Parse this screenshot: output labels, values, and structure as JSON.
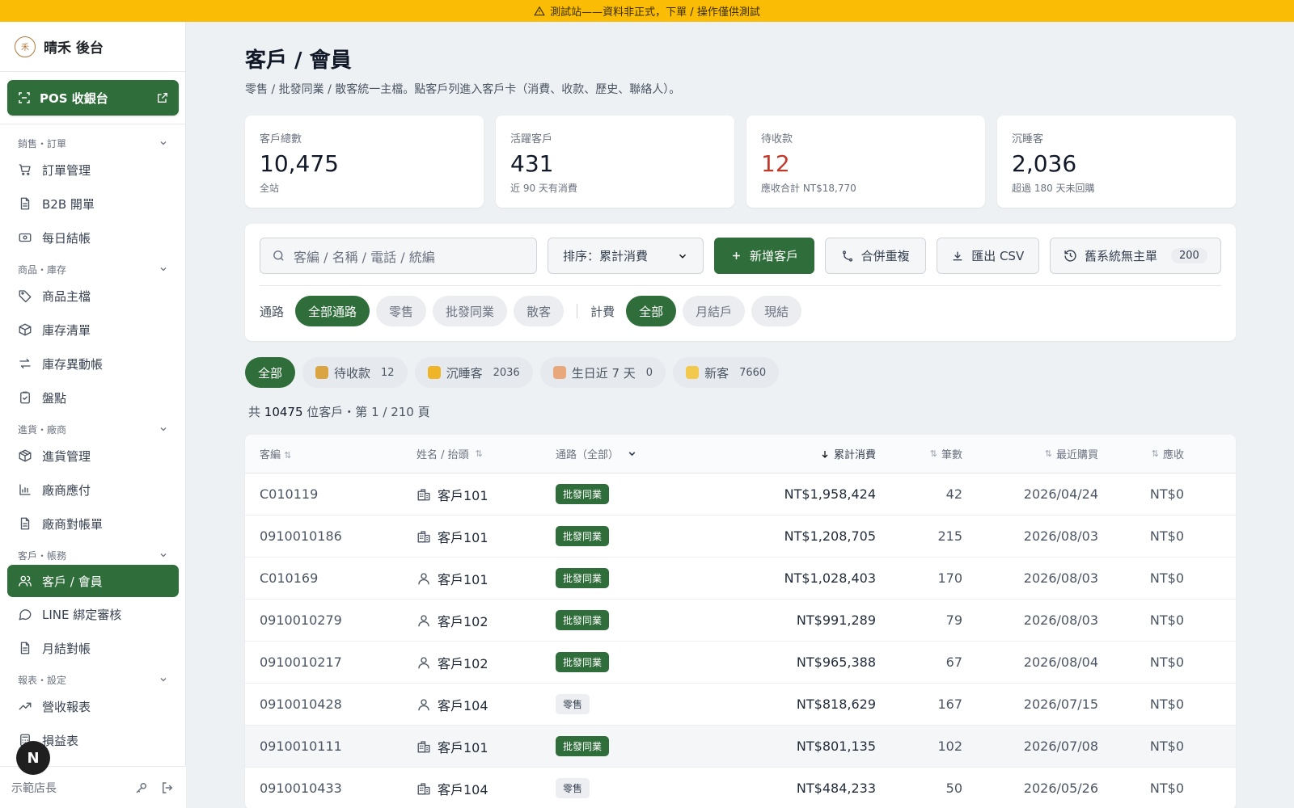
{
  "banner": {
    "text": "測試站——資料非正式，下單 / 操作僅供測試"
  },
  "brand": {
    "logo_text": "禾",
    "name": "晴禾 後台"
  },
  "pos_button": {
    "label": "POS 收銀台"
  },
  "sidebar": {
    "sections": [
      {
        "label": "銷售・訂單",
        "items": [
          {
            "label": "訂單管理",
            "icon": "cart-icon"
          },
          {
            "label": "B2B 開單",
            "icon": "document-icon"
          },
          {
            "label": "每日結帳",
            "icon": "cash-icon"
          }
        ]
      },
      {
        "label": "商品・庫存",
        "items": [
          {
            "label": "商品主檔",
            "icon": "tag-icon"
          },
          {
            "label": "庫存清單",
            "icon": "box-icon"
          },
          {
            "label": "庫存異動帳",
            "icon": "swap-icon"
          },
          {
            "label": "盤點",
            "icon": "clipboard-icon"
          }
        ]
      },
      {
        "label": "進貨・廠商",
        "items": [
          {
            "label": "進貨管理",
            "icon": "package-icon"
          },
          {
            "label": "廠商應付",
            "icon": "chart-icon"
          },
          {
            "label": "廠商對帳單",
            "icon": "document-icon"
          }
        ]
      },
      {
        "label": "客戶・帳務",
        "items": [
          {
            "label": "客戶 / 會員",
            "icon": "users-icon",
            "active": true
          },
          {
            "label": "LINE 綁定審核",
            "icon": "chat-icon"
          },
          {
            "label": "月結對帳",
            "icon": "document-icon"
          }
        ]
      },
      {
        "label": "報表・設定",
        "items": [
          {
            "label": "營收報表",
            "icon": "trend-icon"
          },
          {
            "label": "損益表",
            "icon": "calc-icon"
          }
        ]
      }
    ],
    "footer_user": "示範店長",
    "avatar_letter": "N"
  },
  "page": {
    "title": "客戶 / 會員",
    "subtitle": "零售 / 批發同業 / 散客統一主檔。點客戶列進入客戶卡（消費、收款、歷史、聯絡人）。"
  },
  "stats": [
    {
      "label": "客戶總數",
      "value": "10,475",
      "note": "全站",
      "accent": "#111827"
    },
    {
      "label": "活躍客戶",
      "value": "431",
      "note": "近 90 天有消費",
      "accent": "#111827"
    },
    {
      "label": "待收款",
      "value": "12",
      "note": "應收合計 NT$18,770",
      "accent": "#c0392b"
    },
    {
      "label": "沉睡客",
      "value": "2,036",
      "note": "超過 180 天未回購",
      "accent": "#111827"
    }
  ],
  "toolbar": {
    "search_placeholder": "客編 / 名稱 / 電話 / 統編",
    "sort_value": "排序：累計消費",
    "add_label": "新增客戶",
    "merge_label": "合併重複",
    "export_label": "匯出 CSV",
    "legacy_label": "舊系統無主單",
    "legacy_count": "200"
  },
  "filters": {
    "channel_label": "通路",
    "channels": [
      "全部通路",
      "零售",
      "批發同業",
      "散客"
    ],
    "billing_label": "計費",
    "billing": [
      "全部",
      "月結戶",
      "現結"
    ]
  },
  "segments": [
    {
      "label": "全部",
      "count": ""
    },
    {
      "label": "待收款",
      "count": "12",
      "emoji_color": "#d9a441"
    },
    {
      "label": "沉睡客",
      "count": "2036",
      "emoji_color": "#f0b429"
    },
    {
      "label": "生日近 7 天",
      "count": "0",
      "emoji_color": "#e8a87c"
    },
    {
      "label": "新客",
      "count": "7660",
      "emoji_color": "#f2c94c"
    }
  ],
  "summary": {
    "prefix": "共",
    "total": "10475",
    "suffix": "位客戶・第 1 / 210 頁"
  },
  "table": {
    "headers": {
      "code": "客編",
      "name": "姓名 / 抬頭",
      "channel": "通路（全部）",
      "spend": "累計消費",
      "orders": "筆數",
      "last": "最近購買",
      "receivable": "應收"
    },
    "rows": [
      {
        "code": "C010119",
        "type": "company",
        "name": "客戶101",
        "channel": "批發同業",
        "spend": "NT$1,958,424",
        "orders": "42",
        "last": "2026/04/24",
        "receivable": "NT$0"
      },
      {
        "code": "0910010186",
        "type": "company",
        "name": "客戶101",
        "channel": "批發同業",
        "spend": "NT$1,208,705",
        "orders": "215",
        "last": "2026/08/03",
        "receivable": "NT$0"
      },
      {
        "code": "C010169",
        "type": "person",
        "name": "客戶101",
        "channel": "批發同業",
        "spend": "NT$1,028,403",
        "orders": "170",
        "last": "2026/08/03",
        "receivable": "NT$0"
      },
      {
        "code": "0910010279",
        "type": "person",
        "name": "客戶102",
        "channel": "批發同業",
        "spend": "NT$991,289",
        "orders": "79",
        "last": "2026/08/03",
        "receivable": "NT$0"
      },
      {
        "code": "0910010217",
        "type": "person",
        "name": "客戶102",
        "channel": "批發同業",
        "spend": "NT$965,388",
        "orders": "67",
        "last": "2026/08/04",
        "receivable": "NT$0"
      },
      {
        "code": "0910010428",
        "type": "person",
        "name": "客戶104",
        "channel": "零售",
        "spend": "NT$818,629",
        "orders": "167",
        "last": "2026/07/15",
        "receivable": "NT$0"
      },
      {
        "code": "0910010111",
        "type": "company",
        "name": "客戶101",
        "channel": "批發同業",
        "spend": "NT$801,135",
        "orders": "102",
        "last": "2026/07/08",
        "receivable": "NT$0",
        "highlight": true
      },
      {
        "code": "0910010433",
        "type": "company",
        "name": "客戶104",
        "channel": "零售",
        "spend": "NT$484,233",
        "orders": "50",
        "last": "2026/05/26",
        "receivable": "NT$0"
      }
    ]
  }
}
